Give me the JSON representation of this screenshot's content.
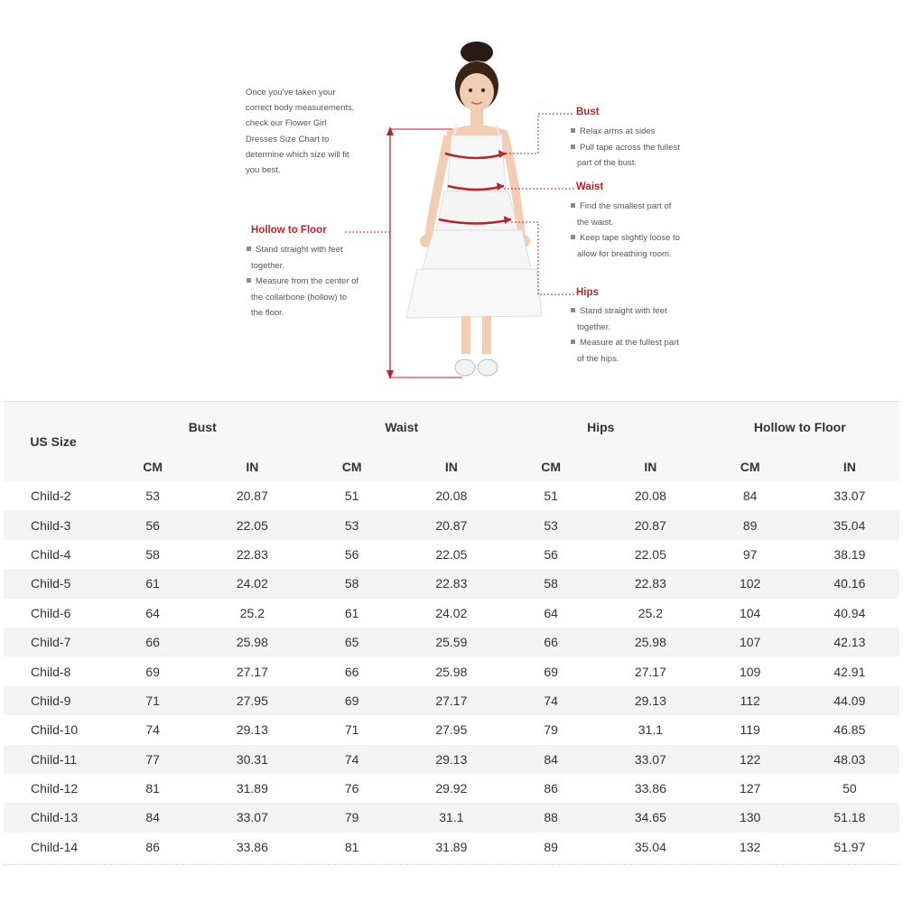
{
  "intro": {
    "lines": [
      "Once you've taken your",
      "correct body measurements,",
      "check our Flower Girl",
      "Dresses Size Chart to",
      "determine which size will fit",
      "you best."
    ]
  },
  "guides": {
    "bust": {
      "title": "Bust",
      "b1a": "Relax arms at sides",
      "b2a": "Pull tape across the fullest",
      "b2b": "part of the bust."
    },
    "waist": {
      "title": "Waist",
      "b1a": "Find the smallest part of",
      "b1b": "the waist.",
      "b2a": "Keep tape slightly loose to",
      "b2b": "allow for breathing room."
    },
    "hips": {
      "title": "Hips",
      "b1a": "Stand straight with feet",
      "b1b": "together.",
      "b2a": "Measure at the fullest part",
      "b2b": "of the hips."
    },
    "hollow": {
      "title": "Hollow to Floor",
      "b1a": "Stand straight with feet",
      "b1b": "together.",
      "b2a": "Measure from the center of",
      "b2b": "the collarbone (hollow) to",
      "b2c": "the floor."
    }
  },
  "table": {
    "size_header": "US Size",
    "groups": [
      "Bust",
      "Waist",
      "Hips",
      "Hollow to Floor"
    ],
    "units": [
      "CM",
      "IN",
      "CM",
      "IN",
      "CM",
      "IN",
      "CM",
      "IN"
    ],
    "rows": [
      [
        "Child-2",
        "53",
        "20.87",
        "51",
        "20.08",
        "51",
        "20.08",
        "84",
        "33.07"
      ],
      [
        "Child-3",
        "56",
        "22.05",
        "53",
        "20.87",
        "53",
        "20.87",
        "89",
        "35.04"
      ],
      [
        "Child-4",
        "58",
        "22.83",
        "56",
        "22.05",
        "56",
        "22.05",
        "97",
        "38.19"
      ],
      [
        "Child-5",
        "61",
        "24.02",
        "58",
        "22.83",
        "58",
        "22.83",
        "102",
        "40.16"
      ],
      [
        "Child-6",
        "64",
        "25.2",
        "61",
        "24.02",
        "64",
        "25.2",
        "104",
        "40.94"
      ],
      [
        "Child-7",
        "66",
        "25.98",
        "65",
        "25.59",
        "66",
        "25.98",
        "107",
        "42.13"
      ],
      [
        "Child-8",
        "69",
        "27.17",
        "66",
        "25.98",
        "69",
        "27.17",
        "109",
        "42.91"
      ],
      [
        "Child-9",
        "71",
        "27.95",
        "69",
        "27.17",
        "74",
        "29.13",
        "112",
        "44.09"
      ],
      [
        "Child-10",
        "74",
        "29.13",
        "71",
        "27.95",
        "79",
        "31.1",
        "119",
        "46.85"
      ],
      [
        "Child-11",
        "77",
        "30.31",
        "74",
        "29.13",
        "84",
        "33.07",
        "122",
        "48.03"
      ],
      [
        "Child-12",
        "81",
        "31.89",
        "76",
        "29.92",
        "86",
        "33.86",
        "127",
        "50"
      ],
      [
        "Child-13",
        "84",
        "33.07",
        "79",
        "31.1",
        "88",
        "34.65",
        "130",
        "51.18"
      ],
      [
        "Child-14",
        "86",
        "33.86",
        "81",
        "31.89",
        "89",
        "35.04",
        "132",
        "51.97"
      ]
    ]
  }
}
